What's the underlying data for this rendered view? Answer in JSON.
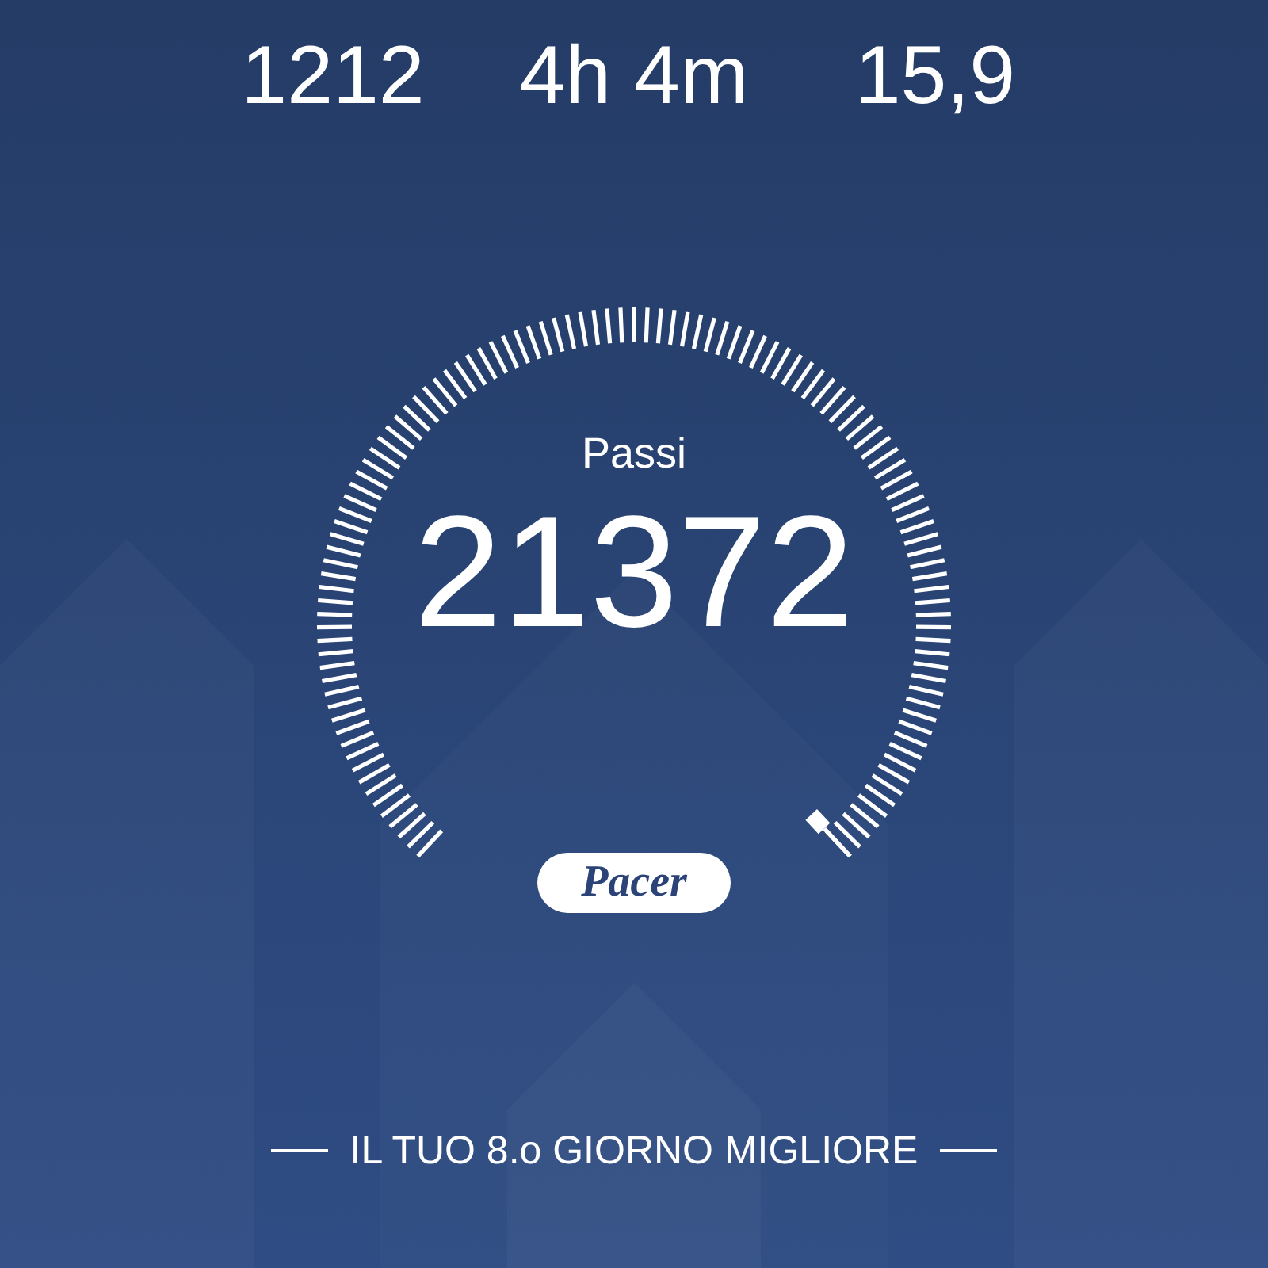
{
  "stats": [
    {
      "value": "1212"
    },
    {
      "value": "4h 4m"
    },
    {
      "value": "15,9"
    }
  ],
  "gauge": {
    "label": "Passi",
    "value": "21372"
  },
  "logo": "Pacer",
  "footer": "IL TUO 8.o GIORNO MIGLIORE"
}
